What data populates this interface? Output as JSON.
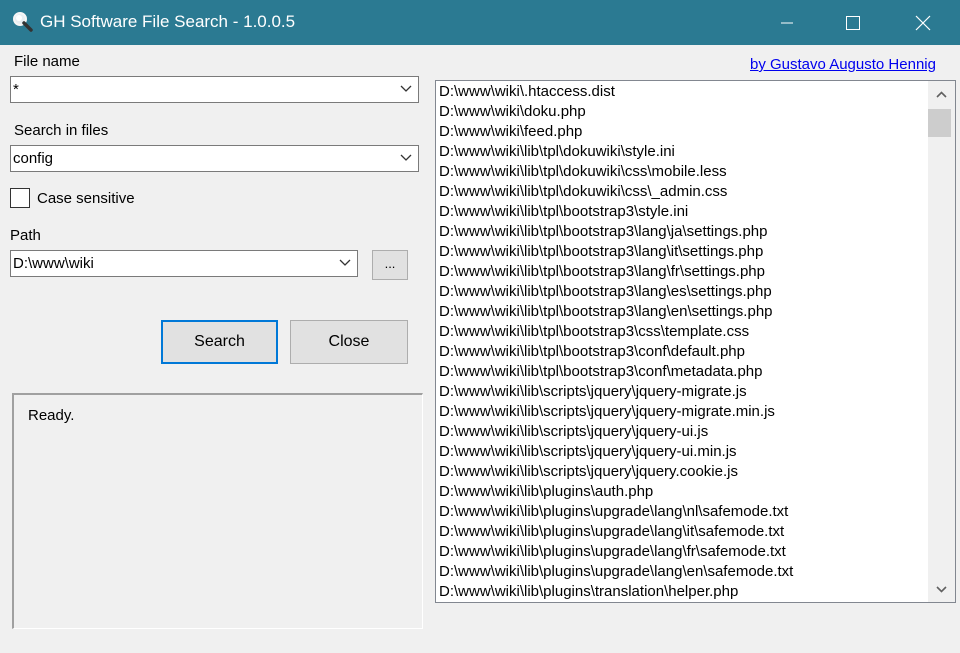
{
  "window": {
    "title": "GH Software File Search - 1.0.0.5",
    "titlebar_color": "#2b7a92"
  },
  "labels": {
    "file_name": "File name",
    "search_in_files": "Search in files",
    "case_sensitive": "Case sensitive",
    "path": "Path"
  },
  "inputs": {
    "file_name_value": "*",
    "search_value": "config",
    "path_value": "D:\\www\\wiki"
  },
  "case_sensitive_checked": false,
  "buttons": {
    "browse": "...",
    "search": "Search",
    "close": "Close"
  },
  "status": "Ready.",
  "author_link": "by Gustavo Augusto Hennig",
  "results": [
    "D:\\www\\wiki\\.htaccess.dist",
    "D:\\www\\wiki\\doku.php",
    "D:\\www\\wiki\\feed.php",
    "D:\\www\\wiki\\lib\\tpl\\dokuwiki\\style.ini",
    "D:\\www\\wiki\\lib\\tpl\\dokuwiki\\css\\mobile.less",
    "D:\\www\\wiki\\lib\\tpl\\dokuwiki\\css\\_admin.css",
    "D:\\www\\wiki\\lib\\tpl\\bootstrap3\\style.ini",
    "D:\\www\\wiki\\lib\\tpl\\bootstrap3\\lang\\ja\\settings.php",
    "D:\\www\\wiki\\lib\\tpl\\bootstrap3\\lang\\it\\settings.php",
    "D:\\www\\wiki\\lib\\tpl\\bootstrap3\\lang\\fr\\settings.php",
    "D:\\www\\wiki\\lib\\tpl\\bootstrap3\\lang\\es\\settings.php",
    "D:\\www\\wiki\\lib\\tpl\\bootstrap3\\lang\\en\\settings.php",
    "D:\\www\\wiki\\lib\\tpl\\bootstrap3\\css\\template.css",
    "D:\\www\\wiki\\lib\\tpl\\bootstrap3\\conf\\default.php",
    "D:\\www\\wiki\\lib\\tpl\\bootstrap3\\conf\\metadata.php",
    "D:\\www\\wiki\\lib\\scripts\\jquery\\jquery-migrate.js",
    "D:\\www\\wiki\\lib\\scripts\\jquery\\jquery-migrate.min.js",
    "D:\\www\\wiki\\lib\\scripts\\jquery\\jquery-ui.js",
    "D:\\www\\wiki\\lib\\scripts\\jquery\\jquery-ui.min.js",
    "D:\\www\\wiki\\lib\\scripts\\jquery\\jquery.cookie.js",
    "D:\\www\\wiki\\lib\\plugins\\auth.php",
    "D:\\www\\wiki\\lib\\plugins\\upgrade\\lang\\nl\\safemode.txt",
    "D:\\www\\wiki\\lib\\plugins\\upgrade\\lang\\it\\safemode.txt",
    "D:\\www\\wiki\\lib\\plugins\\upgrade\\lang\\fr\\safemode.txt",
    "D:\\www\\wiki\\lib\\plugins\\upgrade\\lang\\en\\safemode.txt",
    "D:\\www\\wiki\\lib\\plugins\\translation\\helper.php"
  ],
  "icons": {
    "app": "magnifier-icon",
    "minimize": "minimize-icon",
    "maximize": "maximize-icon",
    "close": "close-icon",
    "dropdown": "chevron-down-icon",
    "scroll_up": "scroll-up-icon",
    "scroll_down": "scroll-down-icon"
  }
}
